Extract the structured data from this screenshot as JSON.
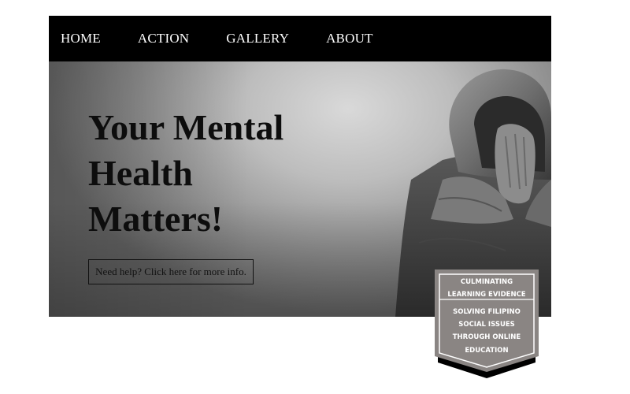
{
  "nav": {
    "items": [
      {
        "label": "HOME"
      },
      {
        "label": "ACTION"
      },
      {
        "label": "GALLERY"
      },
      {
        "label": "ABOUT"
      }
    ]
  },
  "hero": {
    "title_line1": "Your Mental",
    "title_line2": "Health",
    "title_line3": "Matters!",
    "cta_label": "Need help? Click here for more info.",
    "image_subject": "hooded-person-head-down"
  },
  "badge": {
    "line1": "CULMINATING",
    "line2": "LEARNING EVIDENCE",
    "line3": "SOLVING FILIPINO",
    "line4": "SOCIAL ISSUES",
    "line5": "THROUGH ONLINE",
    "line6": "EDUCATION"
  },
  "colors": {
    "navbar": "#000000",
    "nav_text": "#ffffff",
    "title": "#0d0d0d",
    "badge_fill": "#8a8583",
    "badge_border": "#ffffff",
    "badge_shadow": "#000000"
  }
}
